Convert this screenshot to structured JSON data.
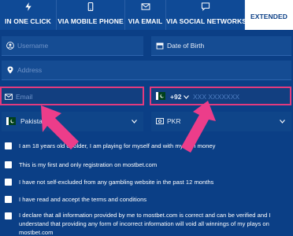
{
  "tabs": [
    {
      "label": "IN ONE CLICK",
      "icon": "flash-icon"
    },
    {
      "label": "VIA MOBILE PHONE",
      "icon": "mobile-phone-icon"
    },
    {
      "label": "VIA EMAIL",
      "icon": "envelope-icon"
    },
    {
      "label": "VIA SOCIAL NETWORKS",
      "icon": "chat-bubble-icon"
    },
    {
      "label": "EXTENDED",
      "icon": ""
    }
  ],
  "form": {
    "username_placeholder": "Username",
    "dob_placeholder": "Date of Birth",
    "address_placeholder": "Address",
    "email_placeholder": "Email",
    "phone_code": "+92",
    "phone_placeholder": "XXX XXXXXXX",
    "country_value": "Pakistan",
    "currency_value": "PKR"
  },
  "checkboxes": [
    {
      "label": "I am 18 years old or older, I am playing for myself and with my own money"
    },
    {
      "label": "This is my first and only registration on mostbet.com"
    },
    {
      "label": "I have not self-excluded from any gambling website in the past 12 months"
    },
    {
      "label": "I have read and accept the terms and conditions"
    },
    {
      "label": "I declare that all information provided by me to mostbet.com is correct and can be verified and I understand that providing any form of incorrect information will void all winnings of my plays on mostbet.com",
      "lines": [
        "I declare that all information provided by me to mostbet.com is correct and can be verified and I",
        "understand that providing any form of incorrect information will void all winnings of my plays on",
        "mostbet.com"
      ]
    }
  ],
  "colors": {
    "background": "#0b3f86",
    "highlight": "#e23a7e",
    "arrow": "#ec3d8a"
  }
}
